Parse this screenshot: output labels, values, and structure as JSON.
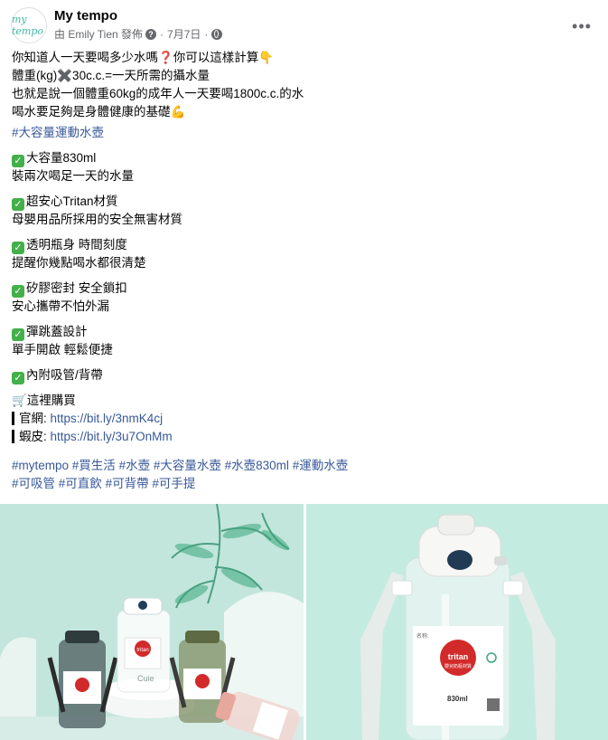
{
  "post": {
    "page_name": "My tempo",
    "avatar_text": "my tempo",
    "author_line": "由 Emily Tien 發佈",
    "date": "7月7日",
    "lines": [
      "你知道人一天要喝多少水嗎❓你可以這樣計算👇",
      "體重(kg)✖️30c.c.=一天所需的攝水量",
      "也就是說一個體重60kg的成年人一天要喝1800c.c.的水",
      "喝水要足夠是身體健康的基礎💪"
    ],
    "hashtag_main": "#大容量運動水壺",
    "features": [
      {
        "title": "大容量830ml",
        "desc": "裝兩次喝足一天的水量"
      },
      {
        "title": "超安心Tritan材質",
        "desc": "母嬰用品所採用的安全無害材質"
      },
      {
        "title": "透明瓶身 時間刻度",
        "desc": "提醒你幾點喝水都很清楚"
      },
      {
        "title": "矽膠密封 安全鎖扣",
        "desc": "安心攜帶不怕外漏"
      },
      {
        "title": "彈跳蓋設計",
        "desc": "單手開啟 輕鬆便捷"
      },
      {
        "title": "內附吸管/背帶",
        "desc": ""
      }
    ],
    "buy_line": "🛒這裡購買",
    "links": [
      {
        "label": "官網: ",
        "url": "https://bit.ly/3nmK4cj"
      },
      {
        "label": "蝦皮: ",
        "url": "https://bit.ly/3u7OnMm"
      }
    ],
    "hashtags_row1": [
      "#mytempo",
      "#買生活",
      "#水壺",
      "#大容量水壺",
      "#水壺830ml",
      "#運動水壺"
    ],
    "hashtags_row2": [
      "#可吸管",
      "#可直飲",
      "#可背帶",
      "#可手提"
    ]
  },
  "images": {
    "left_label_small": "tritan",
    "left_label_brand": "Cuie",
    "right_label_brand": "tritan",
    "right_label_sub": "嬰兒奶瓶材質",
    "right_label_volume": "830ml",
    "right_label_side": "名称:"
  },
  "colors": {
    "link": "#385898",
    "check": "#43b04a",
    "photo_bg": "#c3ebe0"
  },
  "icons": [
    "more-horizontal-icon",
    "question-icon",
    "globe-icon",
    "check-icon"
  ]
}
